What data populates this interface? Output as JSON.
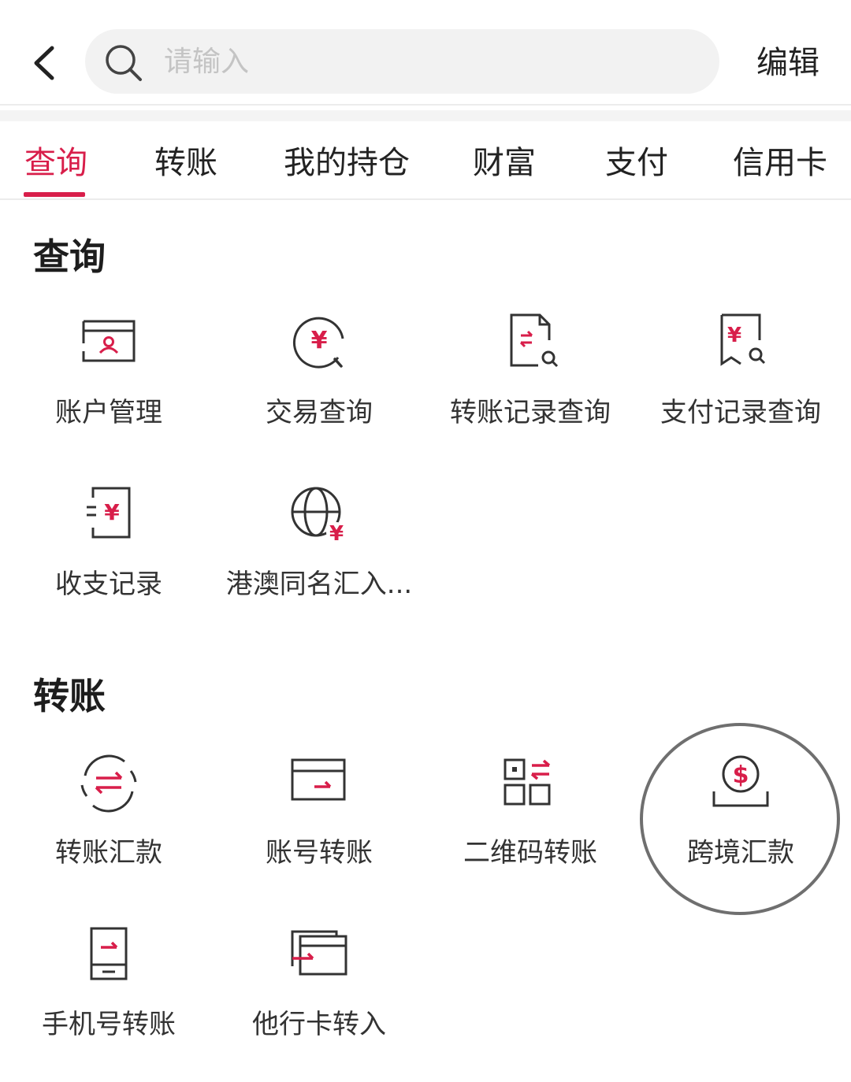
{
  "header": {
    "back_icon": "chevron-left-icon",
    "search_placeholder": "请输入",
    "edit_label": "编辑"
  },
  "tabs": [
    {
      "label": "查询",
      "active": true
    },
    {
      "label": "转账",
      "active": false
    },
    {
      "label": "我的持仓",
      "active": false
    },
    {
      "label": "财富",
      "active": false
    },
    {
      "label": "支付",
      "active": false
    },
    {
      "label": "信用卡",
      "active": false
    }
  ],
  "sections": {
    "query": {
      "title": "查询",
      "items": [
        {
          "label": "账户管理",
          "icon": "account-card-icon"
        },
        {
          "label": "交易查询",
          "icon": "yen-search-icon"
        },
        {
          "label": "转账记录查询",
          "icon": "transfer-doc-search-icon"
        },
        {
          "label": "支付记录查询",
          "icon": "payment-doc-search-icon"
        },
        {
          "label": "收支记录",
          "icon": "income-expense-doc-icon"
        },
        {
          "label": "港澳同名汇入...",
          "icon": "globe-yen-icon"
        }
      ]
    },
    "transfer": {
      "title": "转账",
      "items": [
        {
          "label": "转账汇款",
          "icon": "transfer-circle-icon"
        },
        {
          "label": "账号转账",
          "icon": "account-transfer-icon"
        },
        {
          "label": "二维码转账",
          "icon": "qr-transfer-icon"
        },
        {
          "label": "跨境汇款",
          "icon": "dollar-coin-icon",
          "highlighted": true
        },
        {
          "label": "手机号转账",
          "icon": "phone-transfer-icon"
        },
        {
          "label": "他行卡转入",
          "icon": "card-transfer-in-icon"
        }
      ]
    }
  },
  "colors": {
    "accent": "#d81e4a",
    "text": "#222222",
    "icon_stroke": "#333333",
    "search_bg": "#f2f2f2",
    "highlight_circle": "#6f6f6f"
  }
}
